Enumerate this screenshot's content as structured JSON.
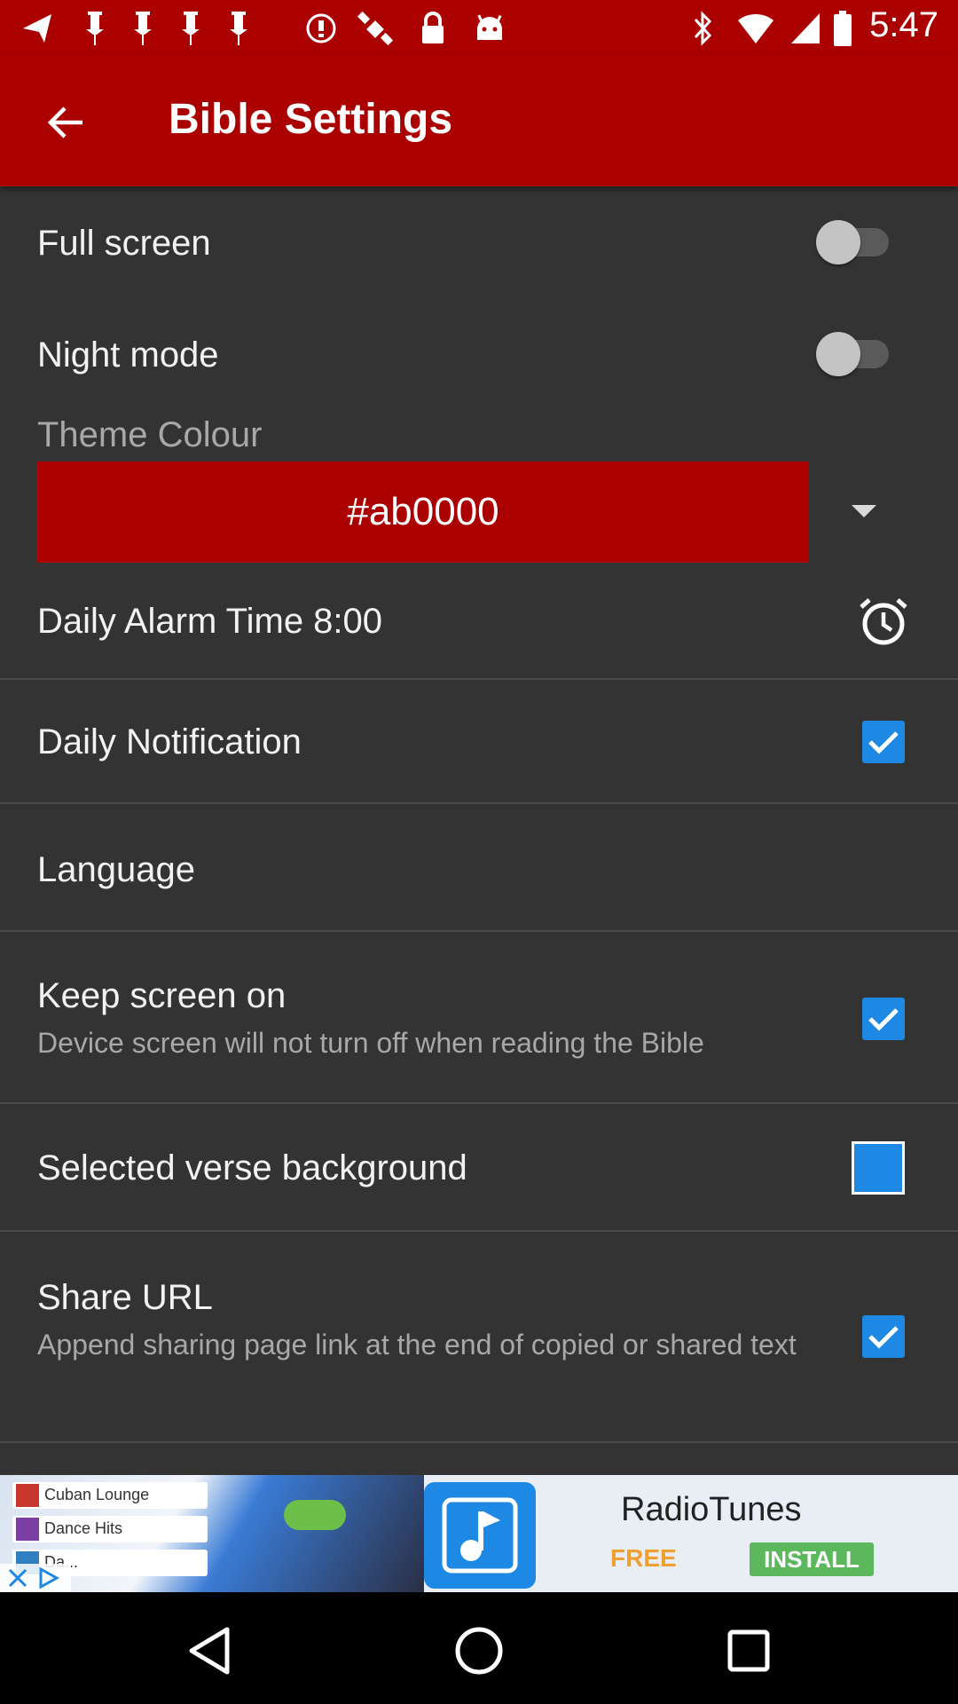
{
  "status_bar": {
    "time": "5:47",
    "left_icons": [
      "navigation-icon",
      "pin-icon",
      "pin-icon",
      "pin-icon",
      "alert-icon",
      "satellite-icon",
      "lock-icon",
      "android-icon"
    ],
    "right_icons": [
      "bluetooth-icon",
      "wifi-icon",
      "signal-icon",
      "battery-icon"
    ]
  },
  "toolbar": {
    "title": "Bible Settings",
    "back_icon": "arrow-back-icon",
    "color": "#ab0000"
  },
  "settings": {
    "full_screen": {
      "label": "Full screen",
      "enabled": false
    },
    "night_mode": {
      "label": "Night mode",
      "enabled": false
    },
    "theme_colour": {
      "label": "Theme Colour",
      "value": "#ab0000"
    },
    "daily_alarm": {
      "label": "Daily Alarm Time 8:00",
      "icon": "alarm-clock-icon"
    },
    "daily_notification": {
      "label": "Daily Notification",
      "checked": true
    },
    "language": {
      "label": "Language"
    },
    "keep_screen_on": {
      "label": "Keep screen on",
      "sub": "Device screen will not turn off when reading the Bible",
      "checked": true
    },
    "selected_verse_background": {
      "label": "Selected verse background",
      "swatch_color": "#1e88e5"
    },
    "share_url": {
      "label": "Share URL",
      "sub": "Append sharing page link at the end of copied or shared text",
      "checked": true
    }
  },
  "ad": {
    "title": "RadioTunes",
    "free_label": "FREE",
    "install_label": "INSTALL",
    "screenshot_rows": [
      "Cuban Lounge",
      "Dance Hits",
      "Da..."
    ]
  },
  "nav_bar": {
    "buttons": [
      "back-triangle-icon",
      "home-circle-icon",
      "recents-square-icon"
    ]
  },
  "colors": {
    "background": "#333333",
    "accent": "#1e88e5",
    "primary": "#ab0000"
  }
}
